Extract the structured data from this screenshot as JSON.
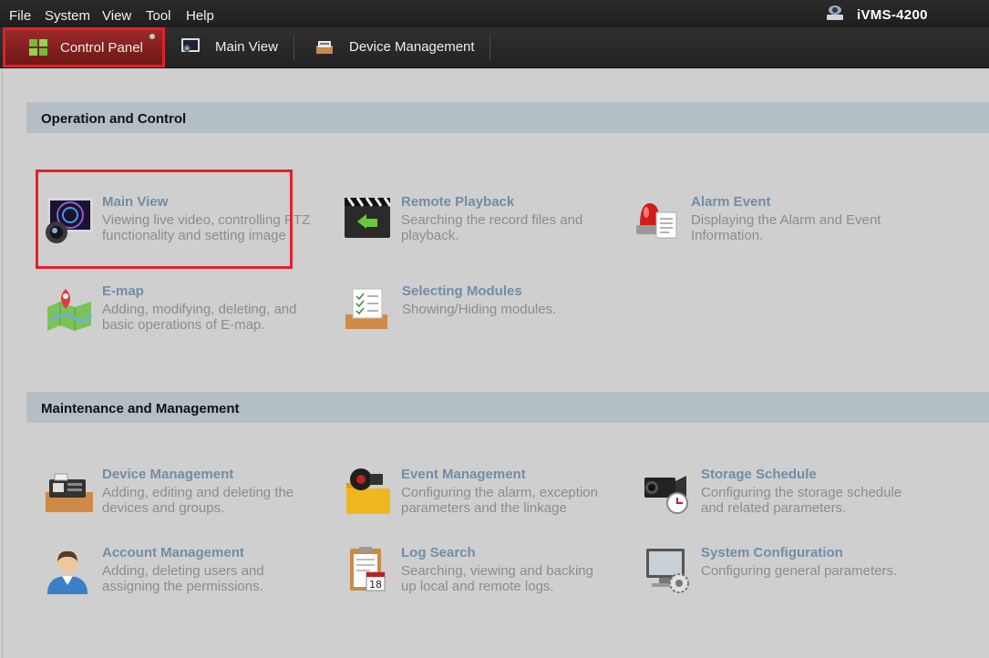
{
  "menu": [
    "File",
    "System",
    "View",
    "Tool",
    "Help"
  ],
  "app_name": "iVMS-4200",
  "tabs": [
    {
      "label": "Control Panel",
      "icon": "grid-icon"
    },
    {
      "label": "Main View",
      "icon": "monitor-icon"
    },
    {
      "label": "Device Management",
      "icon": "device-icon"
    }
  ],
  "sections": [
    {
      "title": "Operation and Control",
      "modules": [
        {
          "title": "Main View",
          "desc": "Viewing live video, controlling PTZ functionality and setting image parameters.",
          "icon": "monitor-camera-icon"
        },
        {
          "title": "Remote Playback",
          "desc": "Searching the record files and playback.",
          "icon": "clapperboard-icon"
        },
        {
          "title": "Alarm Event",
          "desc": "Displaying the Alarm and Event Information.",
          "icon": "alarm-light-icon"
        },
        {
          "title": "E-map",
          "desc": "Adding, modifying, deleting, and basic operations of E-map.",
          "icon": "map-pin-icon"
        },
        {
          "title": "Selecting Modules",
          "desc": "Showing/Hiding modules.",
          "icon": "checklist-icon"
        }
      ]
    },
    {
      "title": "Maintenance and Management",
      "modules": [
        {
          "title": "Device Management",
          "desc": "Adding, editing and deleting the devices and groups.",
          "icon": "device-tray-icon"
        },
        {
          "title": "Event Management",
          "desc": "Configuring the alarm, exception parameters and the linkage actions for the devices.",
          "icon": "event-folder-icon"
        },
        {
          "title": "Storage Schedule",
          "desc": "Configuring the storage schedule and related parameters.",
          "icon": "camcorder-clock-icon"
        },
        {
          "title": "Account Management",
          "desc": "Adding, deleting users and assigning the permissions.",
          "icon": "user-icon"
        },
        {
          "title": "Log Search",
          "desc": "Searching, viewing and backing up local and remote logs.",
          "icon": "calendar-log-icon"
        },
        {
          "title": "System Configuration",
          "desc": "Configuring general parameters.",
          "icon": "computer-gear-icon"
        }
      ]
    }
  ]
}
